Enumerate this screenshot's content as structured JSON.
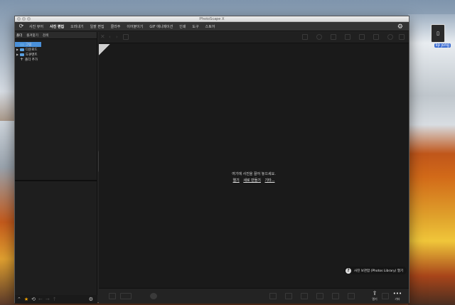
{
  "window": {
    "title": "PhotoScape X"
  },
  "menu": {
    "items": [
      {
        "label": "사진 뷰어",
        "active": false
      },
      {
        "label": "사진 편집",
        "active": true
      },
      {
        "label": "오려내기",
        "active": false
      },
      {
        "label": "일괄 편집",
        "active": false
      },
      {
        "label": "콜라주",
        "active": false
      },
      {
        "label": "이어붙이기",
        "active": false
      },
      {
        "label": "GIF 애니메이션",
        "active": false
      },
      {
        "label": "인쇄",
        "active": false
      },
      {
        "label": "도구",
        "active": false
      },
      {
        "label": "스토어",
        "active": false
      }
    ]
  },
  "left_panel": {
    "tabs": [
      "폴더",
      "즐겨찾기",
      "검색"
    ],
    "tree": [
      {
        "label": "그림",
        "selected": true,
        "arrow": false,
        "icon": "folder"
      },
      {
        "label": "다운로드",
        "selected": false,
        "arrow": true,
        "icon": "folder"
      },
      {
        "label": "도큐멘트",
        "selected": false,
        "arrow": true,
        "icon": "folder"
      },
      {
        "label": "폴더 추가",
        "selected": false,
        "arrow": false,
        "icon": "plus"
      }
    ]
  },
  "main": {
    "drop_message": "여기에 사진을 끌어 놓으세요.",
    "links": [
      "열기",
      "새로 만들기",
      "기타..."
    ]
  },
  "bottom": {
    "share_label": "열기",
    "more_label": "기타"
  },
  "photos_library": {
    "label": "사진 보관함 (Photos Library) 열기"
  },
  "desktop": {
    "icon_label": "tip jong"
  },
  "colors": {
    "accent": "#4a90d9",
    "favorite": "#f0a300"
  }
}
